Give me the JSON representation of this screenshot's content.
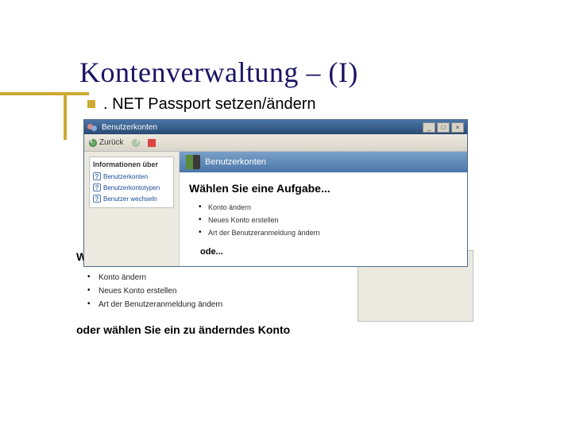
{
  "slide": {
    "title": "Kontenverwaltung – (I)",
    "subtitle": ". NET Passport setzen/ändern"
  },
  "fgwin": {
    "title": "Benutzerkonten",
    "nav_back": "Zurück",
    "win_min": "_",
    "win_max": "□",
    "win_close": "×",
    "side_header": "Informationen über",
    "side_links": [
      "Benutzerkonten",
      "Benutzerkontotypen",
      "Benutzer wechseln"
    ],
    "main_header": "Benutzerkonten",
    "main_heading": "Wählen Sie eine Aufgabe...",
    "tasks": [
      "Konto ändern",
      "Neues Konto erstellen",
      "Art der Benutzeranmeldung ändern"
    ],
    "or_text": "ode..."
  },
  "bgwin": {
    "heading_overlapped": "Wählen Sie eine Aufgabe...",
    "tasks": [
      "Konto ändern",
      "Neues Konto erstellen",
      "Art der Benutzeranmeldung ändern"
    ],
    "or_text": "oder wählen Sie ein zu änderndes Konto",
    "right_item": "Benutzer wechseln"
  }
}
